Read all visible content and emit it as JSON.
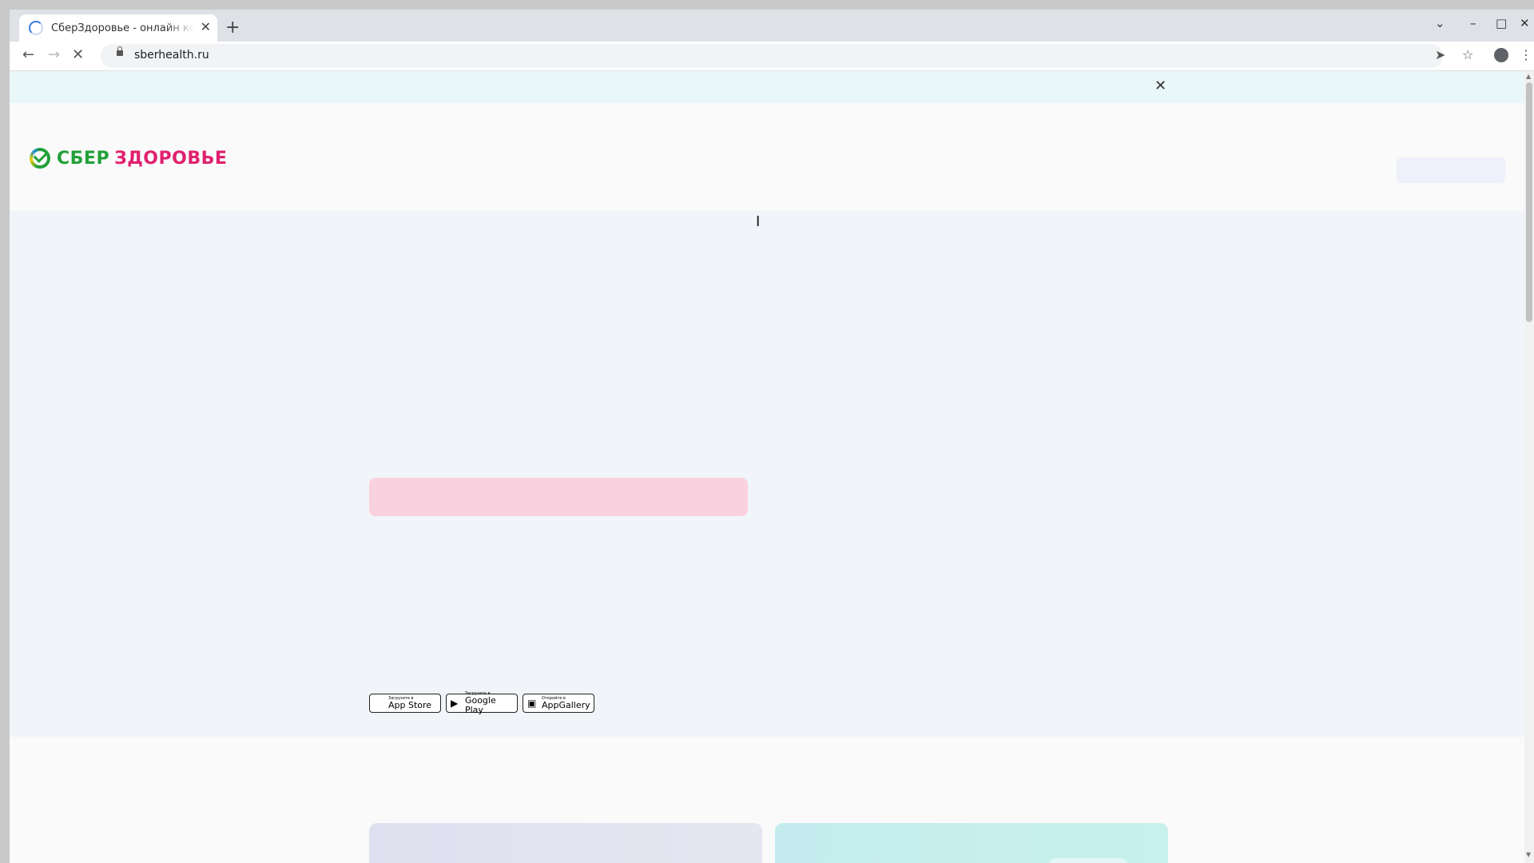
{
  "browser": {
    "tab_title": "СберЗдоровье - онлайн консультации врачей",
    "tab_close": "✕",
    "new_tab": "+",
    "url": "sberhealth.ru",
    "icons": {
      "back": "←",
      "forward": "→",
      "reload_stop": "✕",
      "send": "➤",
      "star": "☆",
      "menu": "⋮",
      "tab_search": "⌄",
      "minimize": "–",
      "maximize": "□",
      "close": "✕"
    }
  },
  "page": {
    "banner_close": "✕",
    "logo": {
      "sber": "СБЕР",
      "health": "ЗДОРОВЬЕ"
    },
    "store_badges": [
      {
        "icon": "",
        "small": "Загрузите в",
        "big": "App Store"
      },
      {
        "icon": "▶",
        "small": "Загрузите в",
        "big": "Google Play"
      },
      {
        "icon": "▣",
        "small": "Откройте в",
        "big": "AppGallery"
      }
    ]
  },
  "colors": {
    "sber_green": "#21a038",
    "health_pink": "#e0206e",
    "hero_placeholder": "#fad1df"
  }
}
